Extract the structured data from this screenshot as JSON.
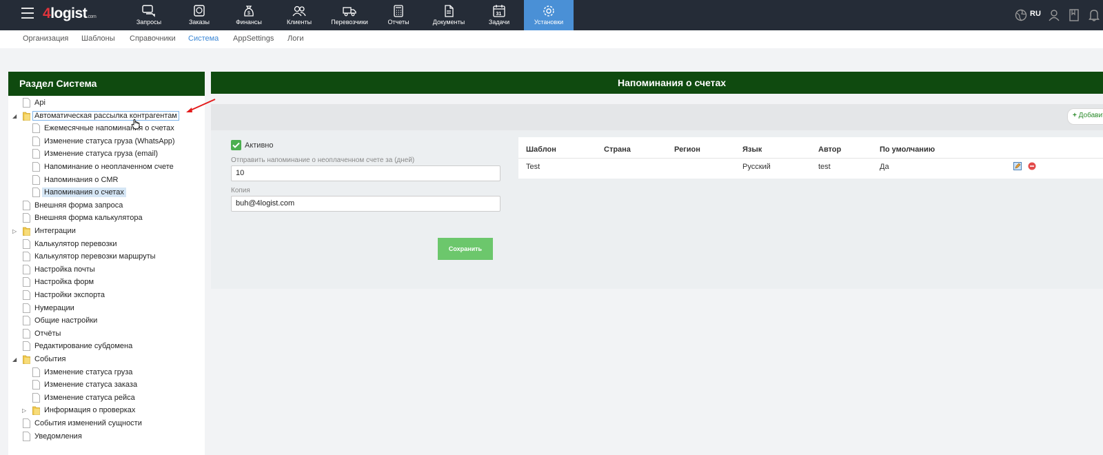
{
  "logo": {
    "four": "4",
    "name": "logist",
    "suffix": ".com"
  },
  "topnav": [
    {
      "label": "Запросы",
      "icon": "chat-icon"
    },
    {
      "label": "Заказы",
      "icon": "globe-box-icon"
    },
    {
      "label": "Финансы",
      "icon": "money-bag-icon"
    },
    {
      "label": "Клиенты",
      "icon": "users-icon"
    },
    {
      "label": "Перевозчики",
      "icon": "truck-icon"
    },
    {
      "label": "Отчеты",
      "icon": "calculator-icon"
    },
    {
      "label": "Документы",
      "icon": "document-icon"
    },
    {
      "label": "Задачи",
      "icon": "calendar-icon",
      "day": "31"
    },
    {
      "label": "Установки",
      "icon": "gear-icon"
    }
  ],
  "lang": "RU",
  "subnav": [
    "Организация",
    "Шаблоны",
    "Справочники",
    "Система",
    "AppSettings",
    "Логи"
  ],
  "left": {
    "title": "Раздел Система",
    "tree": [
      {
        "label": "Api"
      },
      {
        "label": "Автоматическая рассылка контрагентам"
      },
      {
        "label": "Ежемесячные напоминания о счетах"
      },
      {
        "label": "Изменение статуса груза (WhatsApp)"
      },
      {
        "label": "Изменение статуса груза (email)"
      },
      {
        "label": "Напоминание о неоплаченном счете"
      },
      {
        "label": "Напоминания о CMR"
      },
      {
        "label": "Напоминания о счетах"
      },
      {
        "label": "Внешняя форма запроса"
      },
      {
        "label": "Внешняя форма калькулятора"
      },
      {
        "label": "Интеграции"
      },
      {
        "label": "Калькулятор перевозки"
      },
      {
        "label": "Калькулятор перевозки маршруты"
      },
      {
        "label": "Настройка почты"
      },
      {
        "label": "Настройка форм"
      },
      {
        "label": "Настройки экспорта"
      },
      {
        "label": "Нумерации"
      },
      {
        "label": "Общие настройки"
      },
      {
        "label": "Отчёты"
      },
      {
        "label": "Редактирование субдомена"
      },
      {
        "label": "События"
      },
      {
        "label": "Изменение статуса груза"
      },
      {
        "label": "Изменение статуса заказа"
      },
      {
        "label": "Изменение статуса рейса"
      },
      {
        "label": "Информация о проверках"
      },
      {
        "label": "События изменений сущности"
      },
      {
        "label": "Уведомления"
      }
    ]
  },
  "main": {
    "title": "Напоминания о счетах",
    "add_label": "Добавить",
    "active_label": "Активно",
    "days_label": "Отправить напоминание о неоплаченном счете за (дней)",
    "days_value": "10",
    "copy_label": "Копия",
    "copy_value": "buh@4logist.com",
    "save_label": "Сохранить",
    "table": {
      "headers": [
        "Шаблон",
        "Страна",
        "Регион",
        "Язык",
        "Автор",
        "По умолчанию"
      ],
      "rows": [
        {
          "template": "Test",
          "country": "",
          "region": "",
          "lang": "Русский",
          "author": "test",
          "default": "Да"
        }
      ]
    }
  }
}
